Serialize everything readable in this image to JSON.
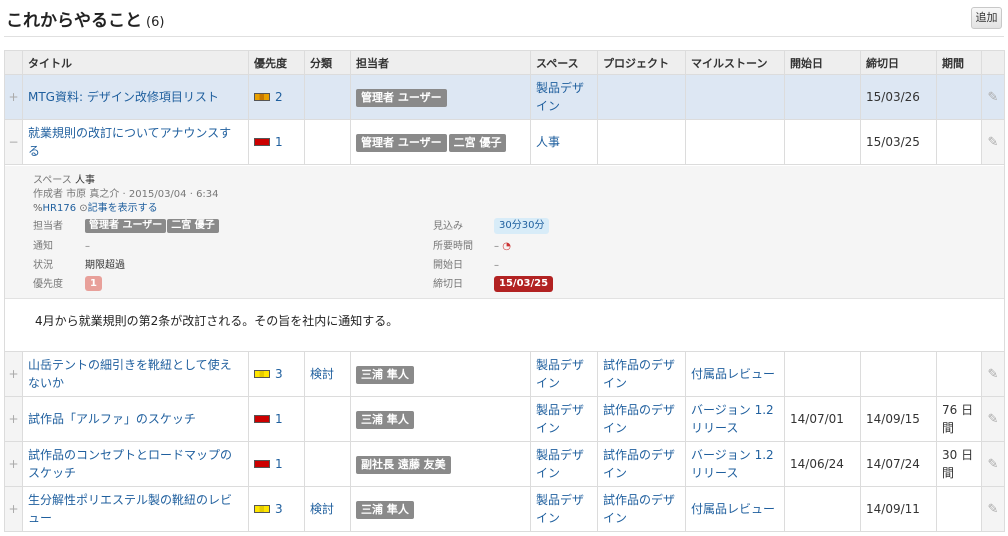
{
  "header": {
    "title": "これからやること",
    "count": "(6)",
    "add_label": "追加"
  },
  "columns": [
    "タイトル",
    "優先度",
    "分類",
    "担当者",
    "スペース",
    "プロジェクト",
    "マイルストーン",
    "開始日",
    "締切日",
    "期間"
  ],
  "rows": [
    {
      "toggle": "+",
      "title": "MTG資料: デザイン改修項目リスト",
      "priority": "2",
      "category": "",
      "assignees": [
        "管理者 ユーザー"
      ],
      "space": "製品デザイン",
      "project": "",
      "milestone": "",
      "start": "",
      "due": "15/03/26",
      "duration": ""
    },
    {
      "toggle": "−",
      "title": "就業規則の改訂についてアナウンスする",
      "priority": "1",
      "category": "",
      "assignees": [
        "管理者 ユーザー",
        "二宮 優子"
      ],
      "space": "人事",
      "project": "",
      "milestone": "",
      "start": "",
      "due": "15/03/25",
      "duration": ""
    },
    {
      "toggle": "+",
      "title": "山岳テントの細引きを靴紐として使えないか",
      "priority": "3",
      "category": "検討",
      "assignees": [
        "三浦 隼人"
      ],
      "space": "製品デザイン",
      "project": "試作品のデザイン",
      "milestone": "付属品レビュー",
      "start": "",
      "due": "",
      "duration": ""
    },
    {
      "toggle": "+",
      "title": "試作品「アルファ」のスケッチ",
      "priority": "1",
      "category": "",
      "assignees": [
        "三浦 隼人"
      ],
      "space": "製品デザイン",
      "project": "試作品のデザイン",
      "milestone": "バージョン 1.2 リリース",
      "start": "14/07/01",
      "due": "14/09/15",
      "duration": "76 日間"
    },
    {
      "toggle": "+",
      "title": "試作品のコンセプトとロードマップのスケッチ",
      "priority": "1",
      "category": "",
      "assignees": [
        "副社長 遠藤 友美"
      ],
      "space": "製品デザイン",
      "project": "試作品のデザイン",
      "milestone": "バージョン 1.2 リリース",
      "start": "14/06/24",
      "due": "14/07/24",
      "duration": "30 日間"
    },
    {
      "toggle": "+",
      "title": "生分解性ポリエステル製の靴紐のレビュー",
      "priority": "3",
      "category": "検討",
      "assignees": [
        "三浦 隼人"
      ],
      "space": "製品デザイン",
      "project": "試作品のデザイン",
      "milestone": "付属品レビュー",
      "start": "",
      "due": "14/09/11",
      "duration": ""
    }
  ],
  "detail": {
    "space_label": "スペース",
    "space_value": "人事",
    "author_line": "作成者 市原 真之介 · 2015/03/04 · 6:34",
    "ref_id": "HR176",
    "view_article": "記事を表示する",
    "assignee_label": "担当者",
    "assignees": [
      "管理者 ユーザー",
      "二宮 優子"
    ],
    "notify_label": "通知",
    "notify_value": "–",
    "status_label": "状況",
    "status_value": "期限超過",
    "priority_label": "優先度",
    "priority_value": "1",
    "estimate_label": "見込み",
    "estimate_value": "30分30分",
    "spent_label": "所要時間",
    "spent_value": "–",
    "start_label": "開始日",
    "start_value": "–",
    "due_label": "締切日",
    "due_value": "15/03/25",
    "body": "4月から就業規則の第2条が改訂される。その旨を社内に通知する。"
  },
  "colors": {
    "header_bg": "#eeeeee",
    "highlight_row": "#dde7f3",
    "link": "#1f5f9e",
    "tag_bg": "#8a8a8a",
    "priority_1": "#cc0000",
    "priority_2": "#e8a000",
    "priority_3": "#ffe600",
    "due_badge": "#b22222"
  },
  "icons": {
    "expand": "plus-icon",
    "collapse": "minus-icon",
    "edit": "pencil-icon",
    "ref": "link-icon",
    "view": "circle-arrow-icon",
    "timer": "stopwatch-icon"
  }
}
